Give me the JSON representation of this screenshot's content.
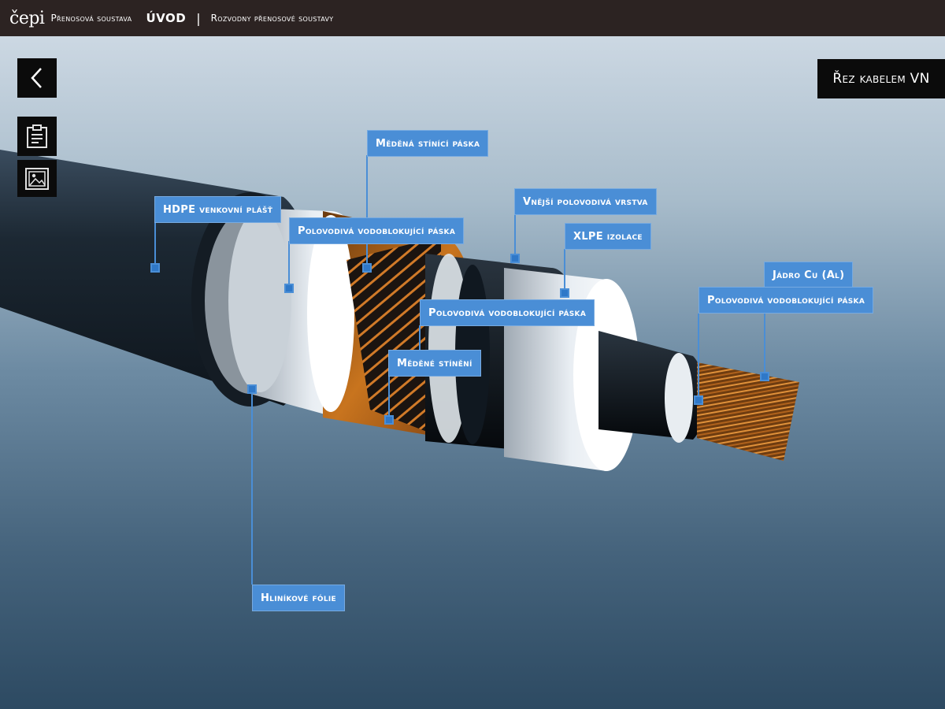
{
  "header": {
    "logo_text": "čepi",
    "company_name": "Přenosová soustava",
    "home_label": "ÚVOD",
    "separator": "|",
    "current_page": "Rozvodny přenosové soustavy"
  },
  "controls": {
    "back_icon": "chevron-left-icon",
    "notes_icon": "clipboard-icon",
    "gallery_icon": "image-icon"
  },
  "view_title": "Řez kabelem VN",
  "labels": {
    "copper_screen_tape": "Měděná stínící páska",
    "hdpe_sheath": "HDPE venkovní plášť",
    "semicond_waterblock_tape_1": "Polovodivá vodoblokující páska",
    "outer_semicond_layer": "Vnější polovodivá vrstva",
    "xlpe_insulation": "XLPE izolace",
    "core": "Jádro Cu (Al)",
    "semicond_waterblock_tape_3": "Polovodivá vodoblokující páska",
    "semicond_waterblock_tape_2": "Polovodivá vodoblokující páska",
    "copper_shielding": "Měděné stínění",
    "aluminium_foil": "Hliníkové fólie"
  },
  "colors": {
    "topbar": "#2c2322",
    "label_bg": "#4a8ed6",
    "leader_line": "#4a8ed6",
    "control_bg": "#0b0b0b"
  }
}
